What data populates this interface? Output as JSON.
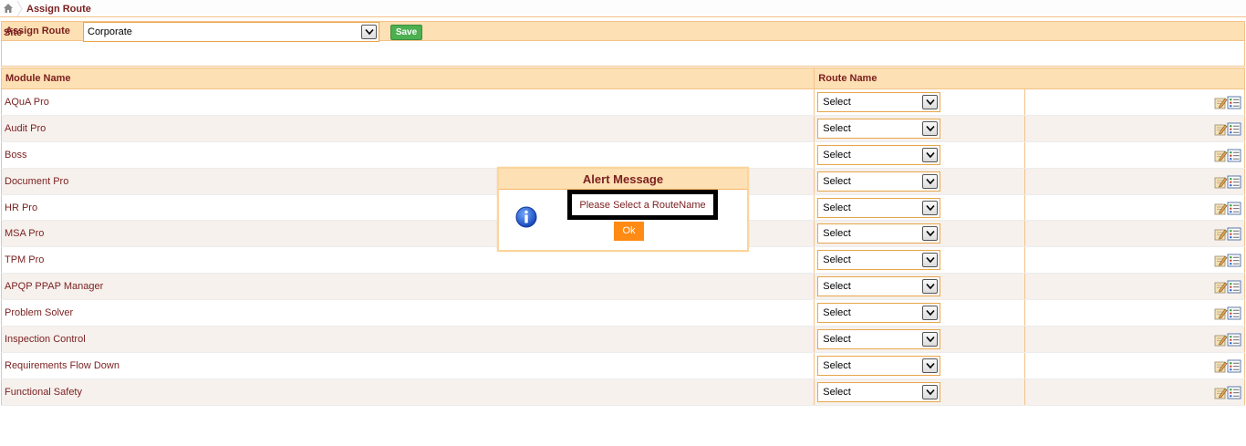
{
  "breadcrumb": {
    "current": "Assign Route"
  },
  "panel": {
    "title": "Assign Route",
    "site_label": "Site",
    "site_value": "Corporate",
    "save_label": "Save"
  },
  "grid": {
    "headers": [
      "Module Name",
      "Route Name"
    ],
    "rows": [
      {
        "module": "AQuA Pro",
        "route": "Select"
      },
      {
        "module": "Audit Pro",
        "route": "Select"
      },
      {
        "module": "Boss",
        "route": "Select"
      },
      {
        "module": "Document Pro",
        "route": "Select"
      },
      {
        "module": "HR Pro",
        "route": "Select"
      },
      {
        "module": "MSA Pro",
        "route": "Select"
      },
      {
        "module": "TPM Pro",
        "route": "Select"
      },
      {
        "module": "APQP PPAP Manager",
        "route": "Select"
      },
      {
        "module": "Problem Solver",
        "route": "Select"
      },
      {
        "module": "Inspection Control",
        "route": "Select"
      },
      {
        "module": "Requirements Flow Down",
        "route": "Select"
      },
      {
        "module": "Functional Safety",
        "route": "Select"
      }
    ]
  },
  "alert": {
    "title": "Alert Message",
    "message": "Please Select a RouteName",
    "ok_label": "Ok"
  },
  "colors": {
    "header_bg": "#fde0b3",
    "border": "#f3c38a",
    "text": "#7a1f1f",
    "save_green": "#4caf50",
    "ok_orange": "#ff8a14"
  }
}
